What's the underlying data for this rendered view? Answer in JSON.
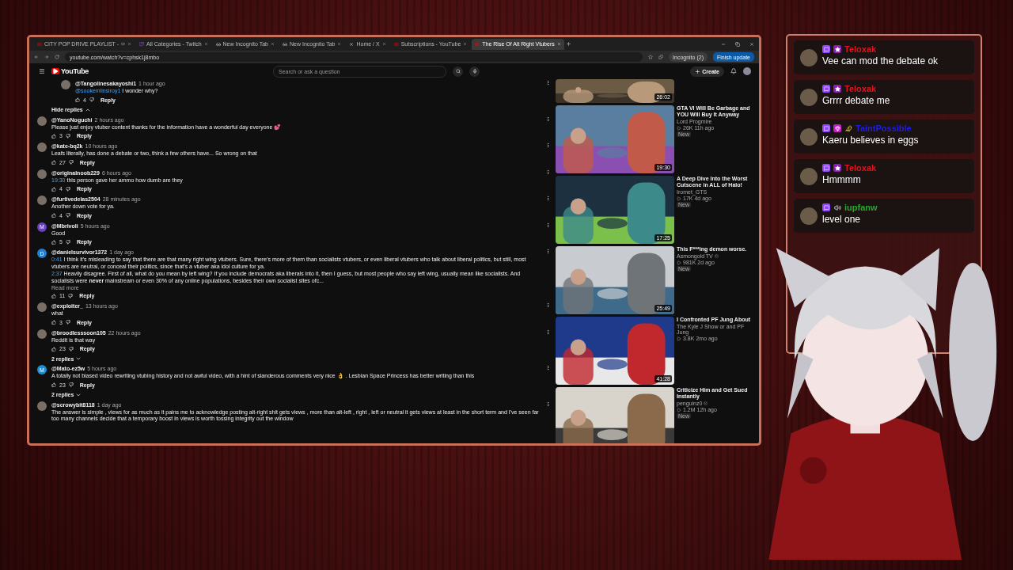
{
  "browser": {
    "tabs": [
      {
        "kind": "youtube",
        "title": "CITY POP DRIVE PLAYLIST -",
        "playing": true,
        "selected": false
      },
      {
        "kind": "twitch",
        "title": "All Categories - Twitch",
        "playing": false,
        "selected": false
      },
      {
        "kind": "incognito",
        "title": "New Incognito Tab",
        "playing": false,
        "selected": false
      },
      {
        "kind": "incognito",
        "title": "New Incognito Tab",
        "playing": false,
        "selected": false
      },
      {
        "kind": "x",
        "title": "Home / X",
        "playing": false,
        "selected": false
      },
      {
        "kind": "youtube",
        "title": "Subscriptions - YouTube",
        "playing": false,
        "selected": false
      },
      {
        "kind": "youtube",
        "title": "The Rise Of Alt Right Vtubers",
        "playing": false,
        "selected": true
      }
    ],
    "address": "youtube.com/watch?v=cphsk1j8mbo",
    "incognito_label": "Incognito (2)",
    "update_button": "Finish update"
  },
  "youtube": {
    "logo": "YouTube",
    "search_placeholder": "Search or ask a question",
    "create_button": "Create"
  },
  "comments": [
    {
      "kind": "reply",
      "author": "@Tangolinesakayoshi1",
      "time": "1 hour ago",
      "paragraphs": [
        {
          "mention": "@sookemlinsiroy1",
          "text": "I wonder why?"
        }
      ],
      "likes": "4",
      "reply_label": "Reply"
    },
    {
      "kind": "toggle",
      "label": "Hide replies",
      "expanded": true
    },
    {
      "kind": "comment",
      "author": "@YanoNoguchi",
      "time": "2 hours ago",
      "paragraphs": [
        {
          "text": "Please just enjoy vtuber content thanks for the information have a wonderful day everyone 💕"
        }
      ],
      "likes": "3",
      "reply_label": "Reply"
    },
    {
      "kind": "comment",
      "author": "@kate-bq2k",
      "time": "10 hours ago",
      "paragraphs": [
        {
          "text": "Leafs literally, has done a debate or two, think a few others have... So wrong on that"
        }
      ],
      "likes": "27",
      "reply_label": "Reply"
    },
    {
      "kind": "comment",
      "author": "@originalnoob229",
      "time": "6 hours ago",
      "paragraphs": [
        {
          "mention": "19:30",
          "text": "this person gave her ammo how dumb are they"
        }
      ],
      "likes": "4",
      "reply_label": "Reply"
    },
    {
      "kind": "comment",
      "author": "@furtivedelas2504",
      "time": "28 minutes ago",
      "paragraphs": [
        {
          "text": "Another down vote for ya."
        }
      ],
      "likes": "4",
      "reply_label": "Reply"
    },
    {
      "kind": "comment",
      "author": "@Mbrivoli",
      "time": "5 hours ago",
      "avatar": {
        "letter": "M",
        "color": "#6a3fc8"
      },
      "paragraphs": [
        {
          "text": "Good"
        }
      ],
      "likes": "5",
      "reply_label": "Reply"
    },
    {
      "kind": "comment",
      "author": "@danielsurvivor1372",
      "time": "1 day ago",
      "avatar": {
        "letter": "D",
        "color": "#1c7fd6"
      },
      "paragraphs": [
        {
          "mention": "0:41",
          "text": "I think it's misleading to say that there are that many right wing vtubers. Sure, there's more of them than socialists vtubers, or even liberal vtubers who talk about liberal politics, but still, most vtubers are neutral, or conceal their politics, since that's a vtuber aka idol culture for ya."
        },
        {
          "mention": "2:37",
          "text": "Heavily disagree. First of all, what do you mean by left wing? If you include democrats aka liberals into it, then I guess, but most people who say left wing, usually mean like socialists. And socialists were **never** mainstream or even 30% of any online populations, besides their own socialist sites ofc..."
        }
      ],
      "read_more": "Read more",
      "likes": "11",
      "reply_label": "Reply"
    },
    {
      "kind": "comment",
      "author": "@exploiter_",
      "time": "13 hours ago",
      "paragraphs": [
        {
          "text": "what"
        }
      ],
      "likes": "3",
      "reply_label": "Reply"
    },
    {
      "kind": "comment",
      "author": "@broodlesssoon105",
      "time": "22 hours ago",
      "paragraphs": [
        {
          "text": "Reddit is that way"
        }
      ],
      "likes": "23",
      "reply_label": "Reply"
    },
    {
      "kind": "toggle",
      "label": "2 replies",
      "expanded": false
    },
    {
      "kind": "comment",
      "author": "@Mato-ez5w",
      "time": "5 hours ago",
      "avatar": {
        "letter": "M",
        "color": "#1c8fd6"
      },
      "paragraphs": [
        {
          "text": "A totally not biased video rewriting vtubing history and not awful video, with a hint of slanderous comments very nice 👌 . Lesbian Space Princess has better writing than this"
        }
      ],
      "likes": "23",
      "reply_label": "Reply"
    },
    {
      "kind": "toggle",
      "label": "2 replies",
      "expanded": false
    },
    {
      "kind": "comment",
      "author": "@scrowybit8118",
      "time": "1 day ago",
      "paragraphs": [
        {
          "text": "The answer is simple , views for as much as it pains me to acknowledge posting alt-right shit gets views , more than alt-left , right , left or neutral it gets views at least in the short term and I've seen far too many channels decide that a temporary boost in views is worth tossing integrity out the window"
        }
      ]
    }
  ],
  "related_videos": [
    {
      "duration": "26:02"
    },
    {
      "duration": "19:30",
      "title": "GTA VI Will Be Garbage and YOU Will Buy It Anyway",
      "channel": "Lord Progmire",
      "verified": false,
      "views": "26K",
      "age": "11h ago",
      "badge": "New"
    },
    {
      "duration": "17:25",
      "title": "A Deep Dive Into the Worst Cutscene in ALL of Halo!",
      "channel": "Iromet_GTS",
      "verified": false,
      "views": "17K",
      "age": "4d ago",
      "badge": "New"
    },
    {
      "duration": "25:49",
      "title": "This F***ing demon worse.",
      "channel": "Asmongold TV",
      "verified": true,
      "views": "981K",
      "age": "2d ago",
      "badge": "New"
    },
    {
      "duration": "41:28",
      "title": "I Confronted PF Jung About",
      "channel": "The Kyle J Show or and PF Jung",
      "verified": false,
      "views": "3.8K",
      "age": "2mo ago"
    },
    {
      "title": "Criticize Him and Get Sued Instantly",
      "channel": "penguinz0",
      "verified": true,
      "views": "1.2M",
      "age": "12h ago",
      "badge": "New"
    }
  ],
  "chat": {
    "messages": [
      {
        "user": "Teloxak",
        "color": "#e0141e",
        "badges": [
          {
            "kind": "chat"
          },
          {
            "kind": "star"
          }
        ],
        "text": "Vee can mod the debate ok"
      },
      {
        "user": "Teloxak",
        "color": "#e0141e",
        "badges": [
          {
            "kind": "chat"
          },
          {
            "kind": "star"
          }
        ],
        "text": "Grrrr debate me"
      },
      {
        "user": "TaintPossible",
        "color": "#1f1fe0",
        "badges": [
          {
            "kind": "chat"
          },
          {
            "kind": "gem"
          },
          {
            "kind": "pet"
          }
        ],
        "text": "Kaeru believes in eggs"
      },
      {
        "user": "Teloxak",
        "color": "#e0141e",
        "badges": [
          {
            "kind": "chat"
          },
          {
            "kind": "star"
          }
        ],
        "text": "Hmmmm"
      },
      {
        "user": "iupfanw",
        "color": "#2ea52e",
        "badges": [
          {
            "kind": "chat"
          },
          {
            "kind": "speaker"
          }
        ],
        "text": "level one"
      }
    ]
  }
}
